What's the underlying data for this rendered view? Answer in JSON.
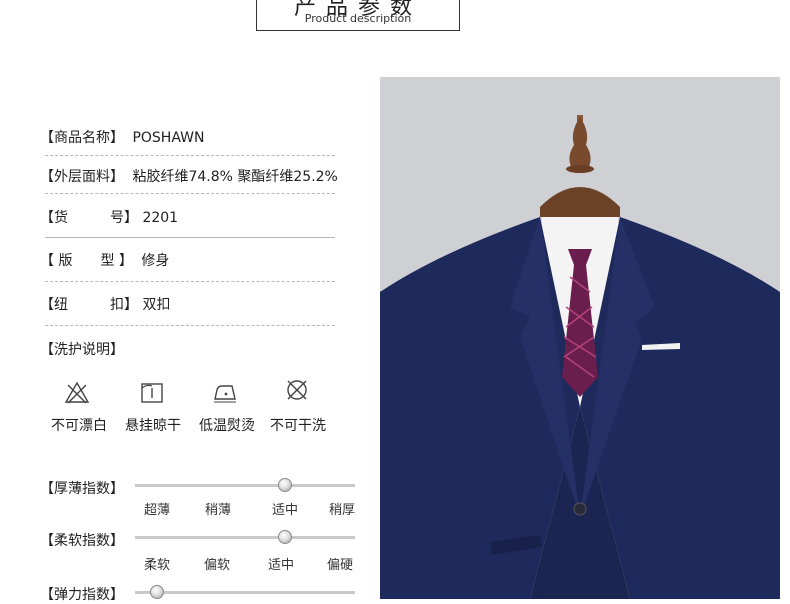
{
  "header": {
    "title_cn": "产品参数",
    "title_en": "Product description"
  },
  "specs": [
    {
      "label": "【商品名称】",
      "value": "POSHAWN"
    },
    {
      "label": "【外层面料】",
      "value": "粘胶纤维74.8% 聚酯纤维25.2%"
    },
    {
      "label": "【货　　　号】",
      "value": "2201"
    },
    {
      "label": "【 版　　型 】",
      "value": "修身"
    },
    {
      "label": "【纽　　　扣】",
      "value": "双扣"
    }
  ],
  "care": {
    "heading": "【洗护说明】",
    "items": [
      {
        "label": "不可漂白",
        "icon": "no-bleach-icon"
      },
      {
        "label": "悬挂晾干",
        "icon": "hang-dry-icon"
      },
      {
        "label": "低温熨烫",
        "icon": "low-iron-icon"
      },
      {
        "label": "不可干洗",
        "icon": "no-dry-clean-icon"
      }
    ]
  },
  "indices": [
    {
      "label": "【厚薄指数】",
      "ticks": [
        "超薄",
        "稍薄",
        "适中",
        "稍厚"
      ],
      "level": 0.68
    },
    {
      "label": "【柔软指数】",
      "ticks": [
        "柔软",
        "偏软",
        "适中",
        "偏硬"
      ],
      "level": 0.68
    },
    {
      "label": "【弹力指数】",
      "ticks": [],
      "level": 0.1
    }
  ],
  "colors": {
    "suit": "#1f2a5c",
    "tie": "#6a1e4e",
    "background": "#cfd0d4"
  },
  "image": {
    "subject": "navy-suit-on-mannequin"
  }
}
